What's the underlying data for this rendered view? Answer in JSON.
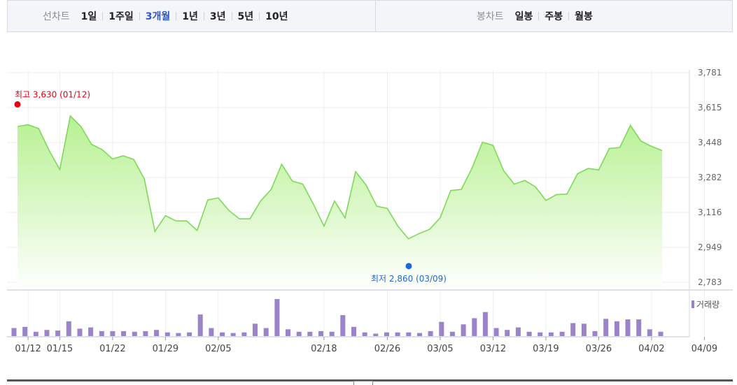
{
  "line_tabs": {
    "caption": "선차트",
    "items": [
      "1일",
      "1주일",
      "3개월",
      "1년",
      "3년",
      "5년",
      "10년"
    ],
    "active": 2
  },
  "candle_tabs": {
    "caption": "봉차트",
    "items": [
      "일봉",
      "주봉",
      "월봉"
    ]
  },
  "chart_data": {
    "type": "area",
    "dates": [
      "01/11",
      "01/12",
      "01/13",
      "01/14",
      "01/15",
      "01/16",
      "01/17",
      "01/18",
      "01/19",
      "01/22",
      "01/23",
      "01/24",
      "01/25",
      "01/26",
      "01/29",
      "01/30",
      "01/31",
      "02/01",
      "02/02",
      "02/05",
      "02/06",
      "02/07",
      "02/08",
      "02/09",
      "02/12",
      "02/13",
      "02/14",
      "02/15",
      "02/16",
      "02/18",
      "02/19",
      "02/20",
      "02/21",
      "02/22",
      "02/23",
      "02/26",
      "02/27",
      "02/28",
      "02/29",
      "03/04",
      "03/05",
      "03/06",
      "03/07",
      "03/08",
      "03/11",
      "03/12",
      "03/13",
      "03/14",
      "03/15",
      "03/18",
      "03/19",
      "03/20",
      "03/21",
      "03/22",
      "03/25",
      "03/26",
      "03/27",
      "03/28",
      "03/29",
      "04/01",
      "04/02",
      "04/03",
      "04/04",
      "04/05",
      "04/08",
      "04/09"
    ],
    "close": [
      3525,
      3533,
      3515,
      3410,
      3320,
      3575,
      3525,
      3440,
      3415,
      3370,
      3385,
      3368,
      3275,
      3025,
      3100,
      3075,
      3075,
      3030,
      3175,
      3185,
      3125,
      3085,
      3085,
      3170,
      3225,
      3345,
      3265,
      3250,
      3155,
      3050,
      3170,
      3090,
      3310,
      3245,
      3145,
      3135,
      3050,
      2990,
      3015,
      3035,
      3090,
      3220,
      3225,
      3325,
      3450,
      3435,
      3315,
      3250,
      3268,
      3238,
      3173,
      3200,
      3203,
      3300,
      3325,
      3318,
      3420,
      3425,
      3530,
      3455,
      3430,
      3410
    ],
    "volume": [
      13,
      15,
      7,
      10,
      9,
      24,
      12,
      14,
      8,
      8,
      8,
      7,
      8,
      10,
      6,
      5,
      6,
      35,
      13,
      6,
      5,
      6,
      20,
      13,
      60,
      11,
      7,
      7,
      8,
      7,
      34,
      15,
      6,
      4,
      6,
      6,
      6,
      5,
      8,
      23,
      7,
      19,
      29,
      39,
      13,
      10,
      14,
      7,
      6,
      6,
      7,
      21,
      20,
      8,
      28,
      24,
      27,
      27,
      11,
      7
    ],
    "price_ticks": [
      "3,781",
      "3,615",
      "3,448",
      "3,282",
      "3,116",
      "2,949",
      "2,783"
    ],
    "ylim": [
      2783,
      3781
    ],
    "x_ticks": [
      "01/12",
      "01/15",
      "01/22",
      "01/29",
      "02/05",
      "02/18",
      "02/26",
      "03/05",
      "03/12",
      "03/19",
      "03/26",
      "04/02",
      "04/09"
    ],
    "high": {
      "label": "최고 3,630 (01/12)",
      "value": 3630
    },
    "low": {
      "label": "최저 2,860 (03/09)",
      "value": 2860
    },
    "volume_legend": "거래량",
    "colors": {
      "line": "#7ed957",
      "fill_top": "#b3f08c",
      "fill_bottom": "#ffffff",
      "volume": "#9b83c9",
      "high": "#e60012",
      "low": "#1f66d8",
      "grid": "#eceef1"
    }
  }
}
